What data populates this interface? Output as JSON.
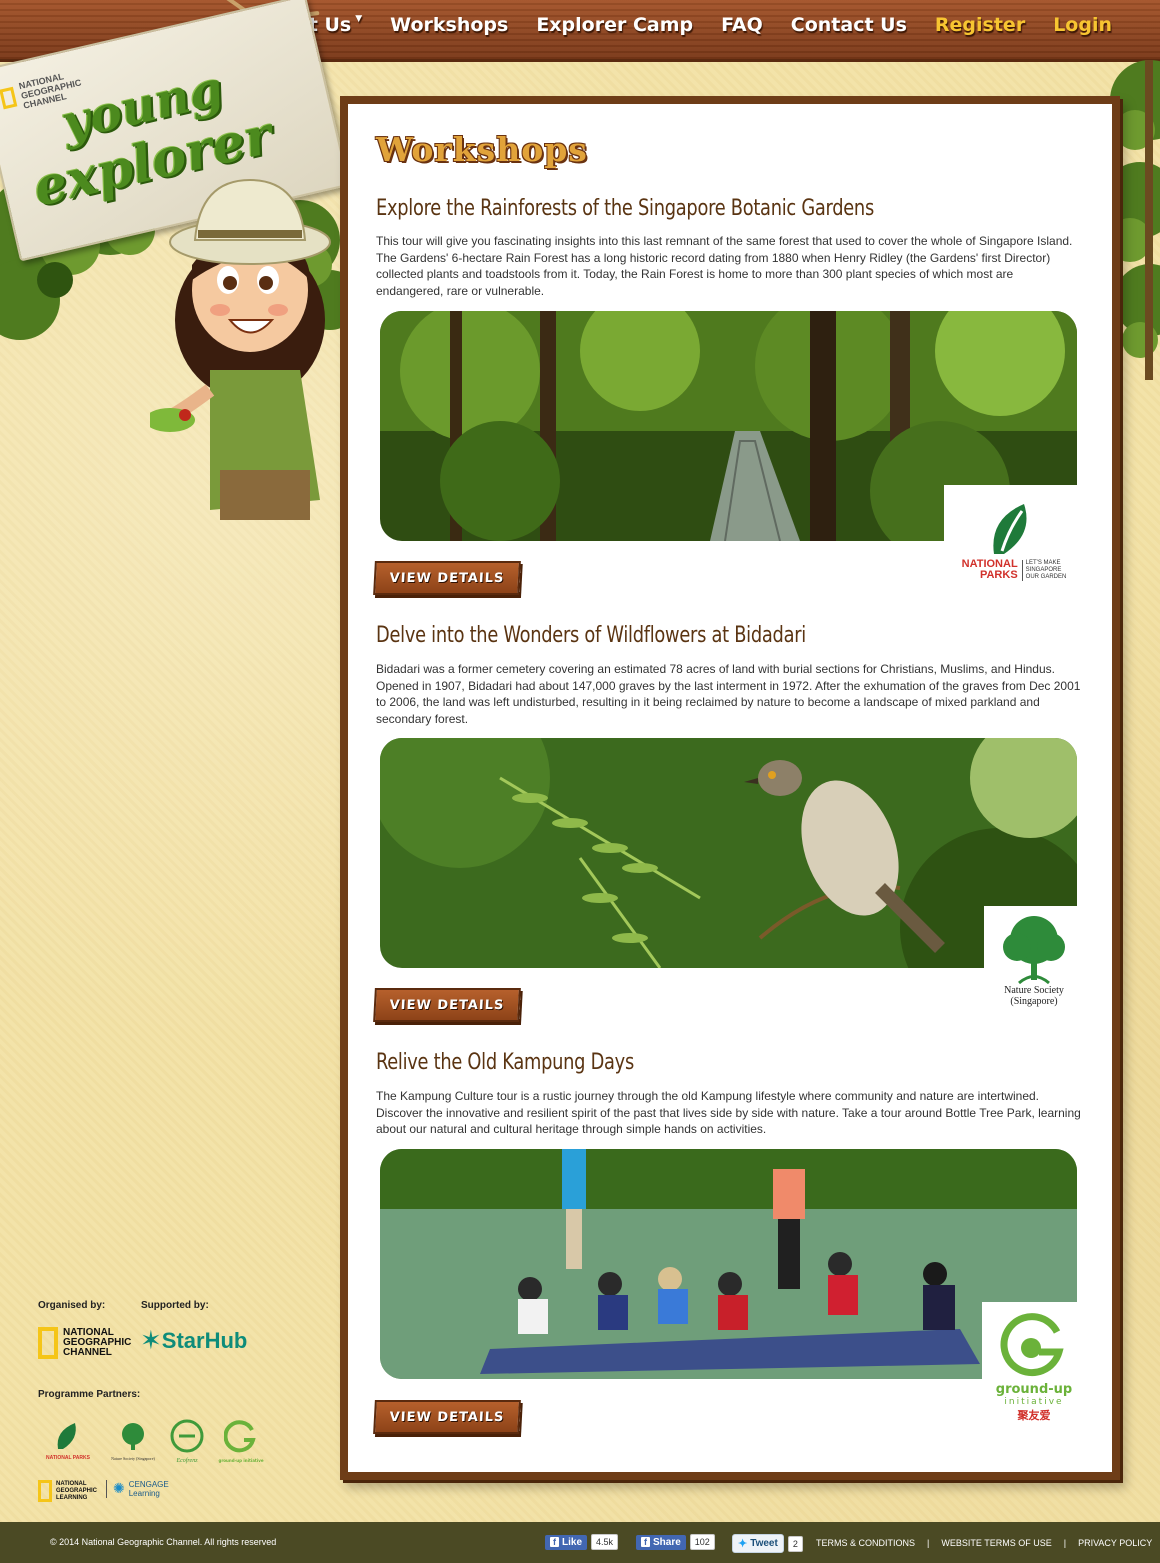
{
  "nav": {
    "items": [
      {
        "label": "About Us",
        "has_caret": true
      },
      {
        "label": "Workshops"
      },
      {
        "label": "Explorer Camp"
      },
      {
        "label": "FAQ"
      },
      {
        "label": "Contact Us"
      }
    ],
    "register": "Register",
    "login": "Login",
    "caret": "▼"
  },
  "logo": {
    "brand_line1": "NATIONAL",
    "brand_line2": "GEOGRAPHIC",
    "brand_line3": "CHANNEL",
    "word1": "young",
    "word2": "explorer"
  },
  "page_title": "Workshops",
  "workshops": [
    {
      "title": "Explore the Rainforests of the Singapore Botanic Gardens",
      "description": "This tour will give you fascinating insights into this last remnant of the same forest that used to cover the whole of Singapore Island. The Gardens' 6-hectare Rain Forest has a long historic record dating from 1880 when Henry Ridley (the Gardens' first Director) collected plants and toadstools from it. Today, the Rain Forest is home to more than 300 plant species of which most are endangered, rare or vulnerable.",
      "button": "VIEW DETAILS",
      "partner": {
        "line1": "NATIONAL",
        "line2": "PARKS",
        "tagline1": "LET'S MAKE",
        "tagline2": "SINGAPORE",
        "tagline3": "OUR GARDEN"
      }
    },
    {
      "title": "Delve into the Wonders of Wildflowers at Bidadari",
      "description": "Bidadari was a former cemetery covering an estimated 78 acres of land with burial sections for Christians, Muslims, and Hindus. Opened in 1907, Bidadari had about 147,000 graves by the last interment in 1972. After the exhumation of the graves from Dec 2001 to 2006, the land was left undisturbed, resulting in it being reclaimed by nature to become a landscape of mixed parkland and secondary forest.",
      "button": "VIEW DETAILS",
      "partner": {
        "line1": "Nature Society",
        "line2": "(Singapore)"
      }
    },
    {
      "title": "Relive the Old Kampung Days",
      "description": "The Kampung Culture tour is a rustic journey through the old Kampung lifestyle where community and nature are intertwined. Discover the innovative and resilient spirit of the past that lives side by side with nature. Take a tour around Bottle Tree Park, learning about our natural and cultural heritage through simple hands on activities.",
      "button": "VIEW DETAILS",
      "partner": {
        "line1": "ground-up",
        "line2": "initiative",
        "line3": "聚友爱"
      }
    }
  ],
  "sidebar": {
    "organised_by": "Organised by:",
    "supported_by": "Supported by:",
    "programme_partners": "Programme Partners:",
    "natgeo_lines": [
      "NATIONAL",
      "GEOGRAPHIC",
      "CHANNEL"
    ],
    "starhub": "StarHub",
    "partners": [
      "NATIONAL PARKS",
      "Nature Society (Singapore)",
      "Ecofrenz",
      "ground-up initiative"
    ],
    "natgeo_learning": [
      "NATIONAL",
      "GEOGRAPHIC",
      "LEARNING"
    ],
    "cengage": [
      "CENGAGE",
      "Learning"
    ]
  },
  "footer": {
    "copyright": "© 2014 National Geographic Channel. All rights reserved",
    "fb_like": "Like",
    "fb_like_count": "4.5k",
    "fb_share": "Share",
    "fb_share_count": "102",
    "tweet": "Tweet",
    "tweet_count": "2",
    "links": [
      "TERMS & CONDITIONS",
      "WEBSITE TERMS OF USE",
      "PRIVACY POLICY"
    ],
    "separator": "|"
  },
  "colors": {
    "header_wood": "#8a4220",
    "nav_gold": "#f7c531",
    "panel_border": "#6e3d17",
    "title_brown": "#5a3412",
    "footer_bg": "#4b4a24"
  }
}
